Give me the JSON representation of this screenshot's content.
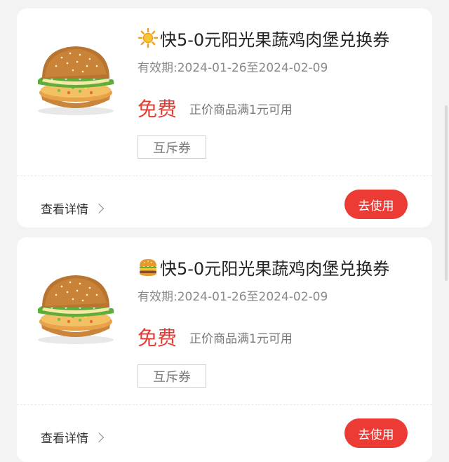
{
  "coupons": [
    {
      "title_icon": "sun-icon",
      "title": "快5-0元阳光果蔬鸡肉堡兑换券",
      "validity": "有效期:2024-01-26至2024-02-09",
      "price": "免费",
      "condition": "正价商品满1元可用",
      "tag": "互斥券",
      "details_label": "查看详情",
      "use_button_label": "去使用"
    },
    {
      "title_icon": "burger-icon",
      "title": "快5-0元阳光果蔬鸡肉堡兑换券",
      "validity": "有效期:2024-01-26至2024-02-09",
      "price": "免费",
      "condition": "正价商品满1元可用",
      "tag": "互斥券",
      "details_label": "查看详情",
      "use_button_label": "去使用"
    }
  ],
  "colors": {
    "accent_red": "#ec3b34",
    "price_red": "#e53b33",
    "background": "#f3f3f3",
    "card": "#ffffff"
  }
}
